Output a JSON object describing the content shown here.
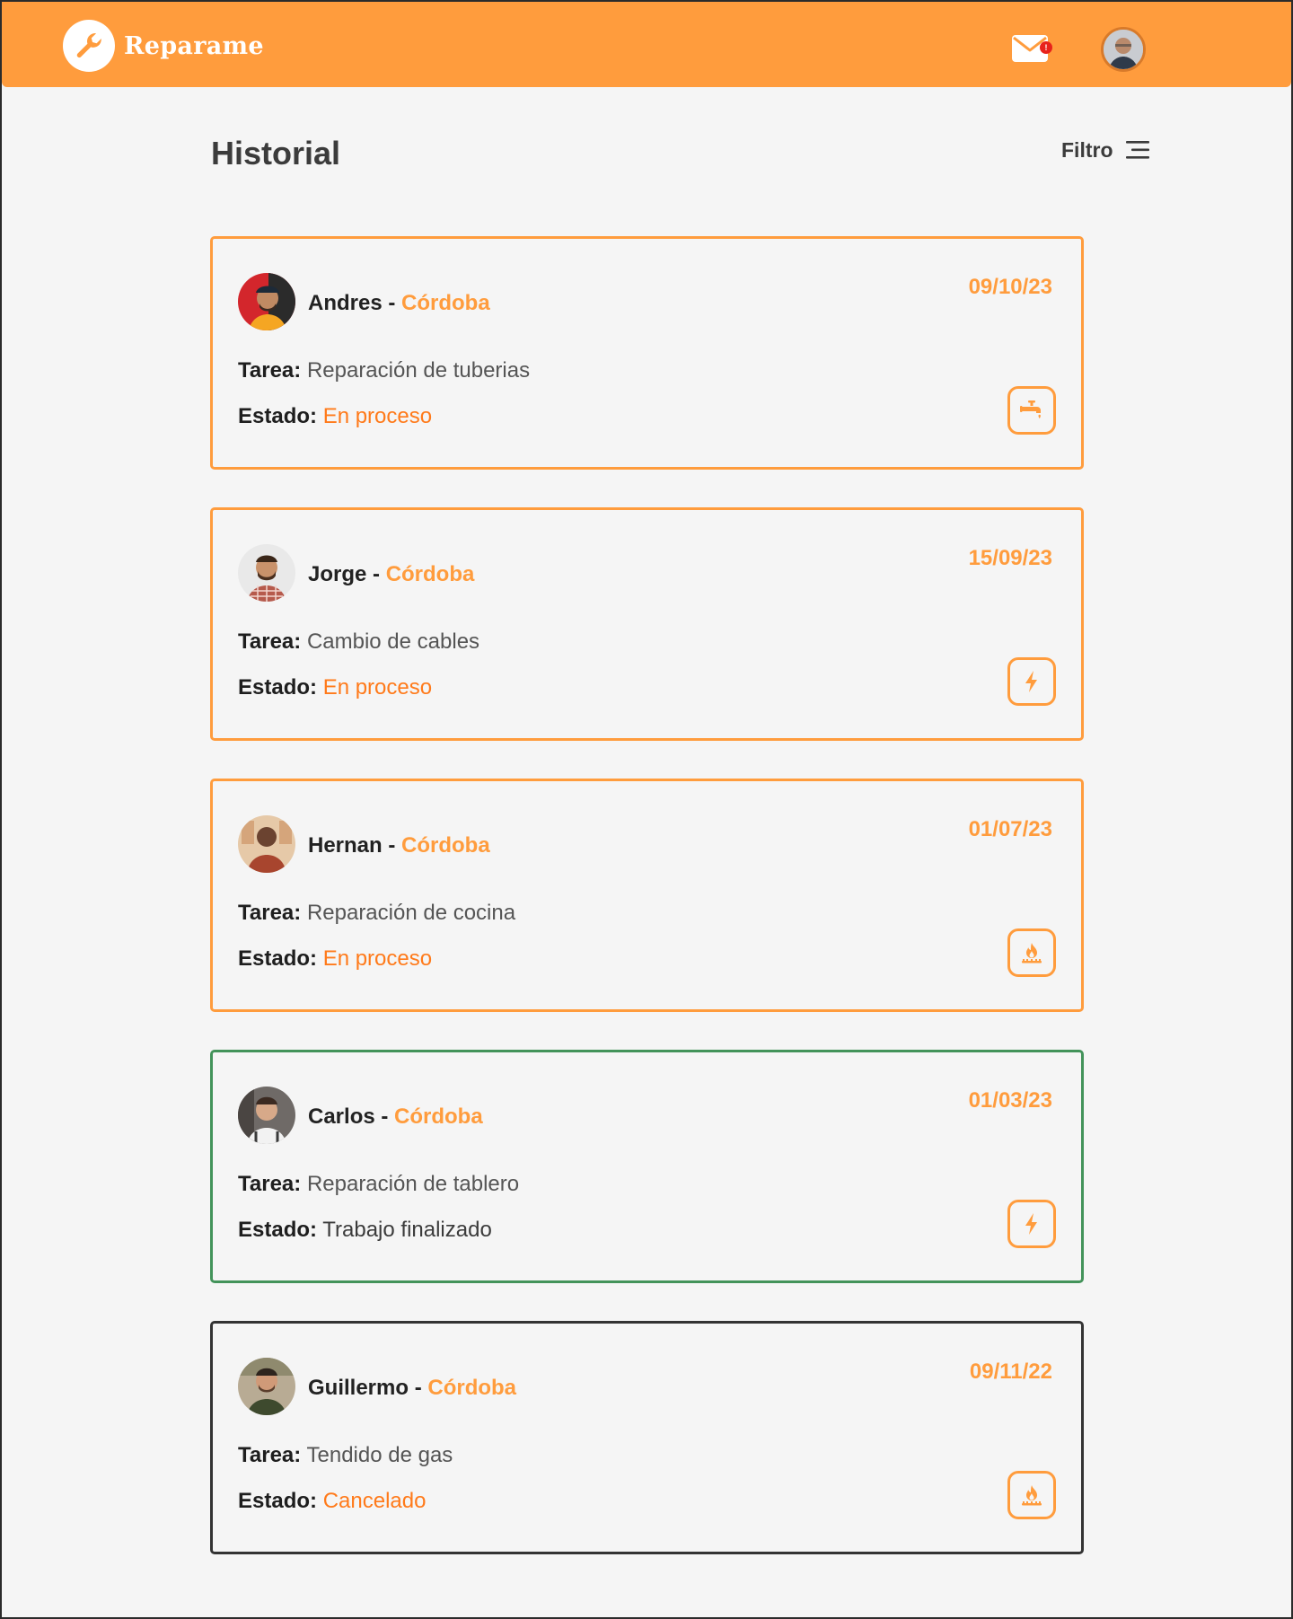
{
  "brand": {
    "name": "Reparame"
  },
  "header": {
    "mail_badge": "!"
  },
  "page": {
    "title": "Historial",
    "filter_label": "Filtro"
  },
  "cards": [
    {
      "name": "Andres",
      "separator": " - ",
      "city": "Córdoba",
      "date": "09/10/23",
      "task_label": "Tarea:",
      "task": "Reparación de tuberias",
      "state_label": "Estado:",
      "state": "En proceso",
      "category_icon": "faucet-icon"
    },
    {
      "name": "Jorge",
      "separator": " - ",
      "city": "Córdoba",
      "date": "15/09/23",
      "task_label": "Tarea:",
      "task": "Cambio de cables",
      "state_label": "Estado:",
      "state": "En proceso",
      "category_icon": "lightning-icon"
    },
    {
      "name": "Hernan",
      "separator": " - ",
      "city": "Córdoba",
      "date": "01/07/23",
      "task_label": "Tarea:",
      "task": "Reparación de cocina",
      "state_label": "Estado:",
      "state": "En proceso",
      "category_icon": "gas-flame-icon"
    },
    {
      "name": "Carlos",
      "separator": " - ",
      "city": "Córdoba",
      "date": "01/03/23",
      "task_label": "Tarea:",
      "task": "Reparación de tablero",
      "state_label": "Estado:",
      "state": "Trabajo finalizado",
      "category_icon": "lightning-icon"
    },
    {
      "name": "Guillermo",
      "separator": " - ",
      "city": "Córdoba",
      "date": "09/11/22",
      "task_label": "Tarea:",
      "task": "Tendido de gas",
      "state_label": "Estado:",
      "state": "Cancelado",
      "category_icon": "gas-flame-icon"
    }
  ],
  "colors": {
    "brand_orange": "#ff9c3d",
    "status_orange": "#ff7a1a",
    "finished_green": "#43935a",
    "cancelled_dark": "#333333"
  }
}
